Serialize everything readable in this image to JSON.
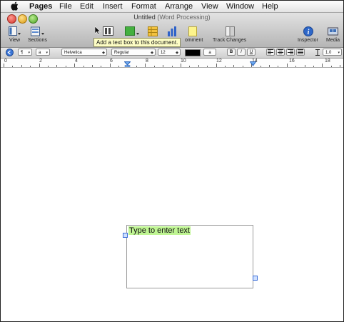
{
  "menubar": {
    "app_name": "Pages",
    "items": [
      "File",
      "Edit",
      "Insert",
      "Format",
      "Arrange",
      "View",
      "Window",
      "Help"
    ]
  },
  "window": {
    "title": "Untitled",
    "subtitle": "(Word Processing)"
  },
  "toolbar": {
    "view_label": "View",
    "sections_label": "Sections",
    "comment_label": "omment",
    "track_changes_label": "Track Changes",
    "inspector_label": "Inspector",
    "media_label": "Media"
  },
  "tooltip": "Add a text box to this document.",
  "formatbar": {
    "paragraph_style": "¶",
    "char_style": "a",
    "font_family": "Helvetica",
    "font_style": "Regular",
    "font_size": "12",
    "text_color": "#000000",
    "highlight_letter": "a",
    "bold": "B",
    "italic": "I",
    "underline": "U",
    "line_spacing": "1.0"
  },
  "ruler": {
    "numbers": [
      "0",
      "2",
      "4",
      "6",
      "8",
      "10",
      "12",
      "14",
      "16",
      "18"
    ]
  },
  "document": {
    "textbox_placeholder": "Type to enter text"
  },
  "colors": {
    "placeholder_highlight": "#bff593",
    "tooltip_bg": "#fdfdc5"
  }
}
